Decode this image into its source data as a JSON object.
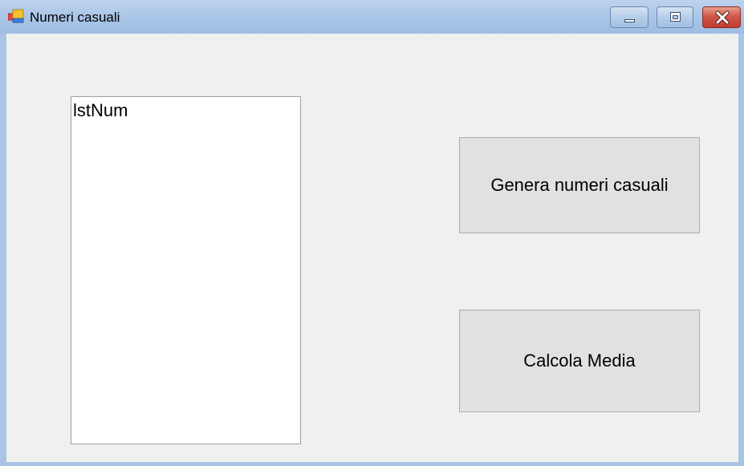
{
  "window": {
    "title": "Numeri casuali",
    "icon": "winforms-app-icon",
    "controls": {
      "minimize_icon": "minimize-icon",
      "maximize_icon": "maximize-icon",
      "close_icon": "close-icon"
    }
  },
  "form": {
    "listbox": {
      "items": [
        "lstNum"
      ]
    },
    "buttons": {
      "genera_label": "Genera numeri casuali",
      "calcola_label": "Calcola Media"
    }
  },
  "colors": {
    "titlebar": "#a8c4e6",
    "client_background": "#f0f0f0",
    "button_face": "#e1e1e1",
    "close_button": "#c94a3c"
  }
}
